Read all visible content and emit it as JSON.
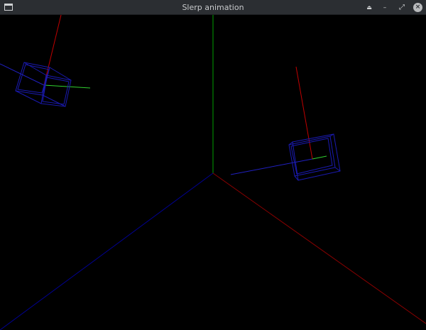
{
  "window": {
    "title": "Slerp animation",
    "background": "#000000"
  },
  "titlebar": {
    "app_icon": "window-icon",
    "buttons": [
      {
        "name": "keep-above",
        "glyph": "⏏"
      },
      {
        "name": "minimize",
        "glyph": "–"
      },
      {
        "name": "maximize",
        "glyph": "⤢"
      },
      {
        "name": "close",
        "glyph": "×"
      }
    ]
  },
  "scene": {
    "axis_colors": {
      "x": "#8a0000",
      "y": "#00a000",
      "z": "#000090"
    },
    "cube_color": "#1a1ab0",
    "cube_axis_colors": {
      "x": "#c00000",
      "y": "#30d030",
      "z": "#2020c0"
    }
  }
}
